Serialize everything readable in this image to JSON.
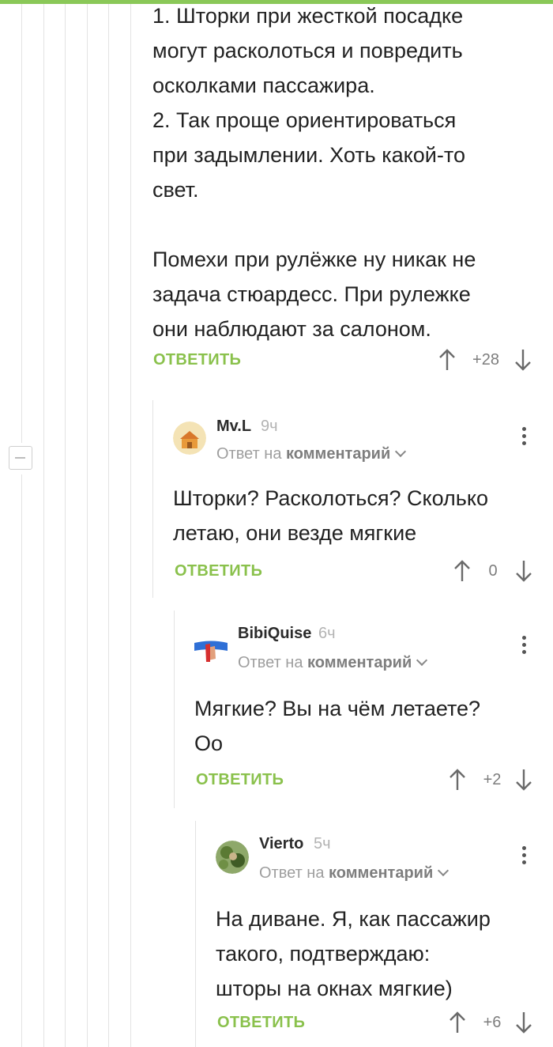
{
  "colors": {
    "accent": "#8ac858",
    "reply_green": "#8ac14c"
  },
  "comments": [
    {
      "text": "1. Шторки при жесткой посадке\nмогут расколоться и повредить\nосколками пассажира.\n2. Так проще ориентироваться\nпри задымлении. Хоть какой-то\nсвет.\n\nПомехи при рулёжке ну никак не\nзадача стюардесс. При рулежке\nони наблюдают за салоном.",
      "reply_label": "ОТВЕТИТЬ",
      "score": "+28"
    },
    {
      "author": "Mv.L",
      "time": "9ч",
      "reply_to_prefix": "Ответ на",
      "reply_to_target": "комментарий",
      "text": "Шторки? Расколоться? Сколько\nлетаю, они везде мягкие",
      "reply_label": "ОТВЕТИТЬ",
      "score": "0"
    },
    {
      "author": "BibiQuise",
      "time": "6ч",
      "reply_to_prefix": "Ответ на",
      "reply_to_target": "комментарий",
      "text": "Мягкие? Вы на чём летаете?\nOo",
      "reply_label": "ОТВЕТИТЬ",
      "score": "+2"
    },
    {
      "author": "Vierto",
      "time": "5ч",
      "reply_to_prefix": "Ответ на",
      "reply_to_target": "комментарий",
      "text": "На диване. Я, как пассажир\nтакого, подтверждаю:\nшторы на окнах мягкие)",
      "reply_label": "ОТВЕТИТЬ",
      "score": "+6"
    }
  ],
  "icons": {
    "upvote": "arrow-up-icon",
    "downvote": "arrow-down-icon",
    "more": "more-vertical-icon",
    "collapse": "collapse-minus-icon",
    "reply_dropdown": "chevron-down-icon"
  }
}
